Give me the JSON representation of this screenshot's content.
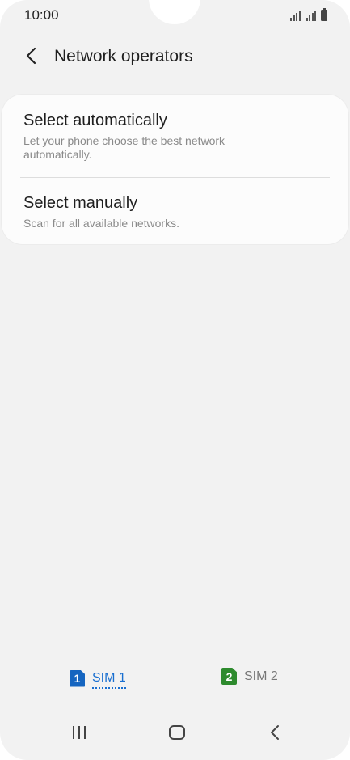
{
  "status_bar": {
    "time": "10:00"
  },
  "header": {
    "title": "Network operators"
  },
  "options": [
    {
      "title": "Select automatically",
      "description": "Let your phone choose the best network automatically."
    },
    {
      "title": "Select manually",
      "description": "Scan for all available networks."
    }
  ],
  "sim_tabs": [
    {
      "badge": "1",
      "label": "SIM 1",
      "selected": true,
      "color": "#1565c0"
    },
    {
      "badge": "2",
      "label": "SIM 2",
      "selected": false,
      "color": "#2e8b2e"
    }
  ],
  "colors": {
    "background": "#f2f2f2",
    "card": "#fcfcfc",
    "accent": "#1a6fd0"
  },
  "icons": {
    "back": "chevron-left-icon",
    "recent": "recent-apps-icon",
    "home": "home-icon",
    "nav_back": "nav-back-icon"
  }
}
